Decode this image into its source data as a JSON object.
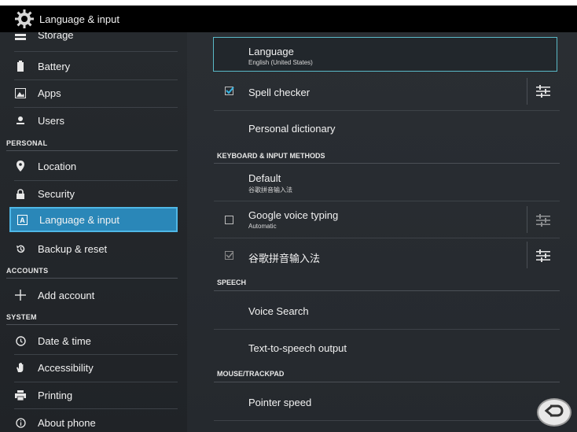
{
  "window": {
    "title": "Language & input",
    "icon": "gear-icon"
  },
  "sidebar": {
    "items": [
      {
        "label": "Storage",
        "icon": "storage-icon"
      },
      {
        "label": "Battery",
        "icon": "battery-icon"
      },
      {
        "label": "Apps",
        "icon": "apps-icon"
      },
      {
        "label": "Users",
        "icon": "users-icon"
      },
      {
        "label": "Location",
        "icon": "location-icon"
      },
      {
        "label": "Security",
        "icon": "lock-icon"
      },
      {
        "label": "Language & input",
        "icon": "language-icon",
        "selected": true
      },
      {
        "label": "Backup & reset",
        "icon": "backup-icon"
      },
      {
        "label": "Add account",
        "icon": "plus-icon"
      },
      {
        "label": "Date & time",
        "icon": "clock-icon"
      },
      {
        "label": "Accessibility",
        "icon": "hand-icon"
      },
      {
        "label": "Printing",
        "icon": "printer-icon"
      },
      {
        "label": "About phone",
        "icon": "info-icon"
      }
    ],
    "headers": {
      "personal": "PERSONAL",
      "accounts": "ACCOUNTS",
      "system": "SYSTEM"
    }
  },
  "main": {
    "language": {
      "title": "Language",
      "subtitle": "English (United States)"
    },
    "spell_checker": {
      "title": "Spell checker",
      "checked": true
    },
    "personal_dictionary": {
      "title": "Personal dictionary"
    },
    "keyboard_header": "KEYBOARD & INPUT METHODS",
    "default": {
      "title": "Default",
      "subtitle": "谷歌拼音输入法"
    },
    "google_voice": {
      "title": "Google voice typing",
      "subtitle": "Automatic",
      "checked": false
    },
    "pinyin": {
      "title": "谷歌拼音输入法",
      "checked": true
    },
    "speech_header": "SPEECH",
    "voice_search": {
      "title": "Voice Search"
    },
    "tts": {
      "title": "Text-to-speech output"
    },
    "mouse_header": "MOUSE/TRACKPAD",
    "pointer_speed": {
      "title": "Pointer speed"
    }
  },
  "colors": {
    "accent": "#2a87b8",
    "highlight_border": "#5ab9c7",
    "background": "#25292e"
  }
}
